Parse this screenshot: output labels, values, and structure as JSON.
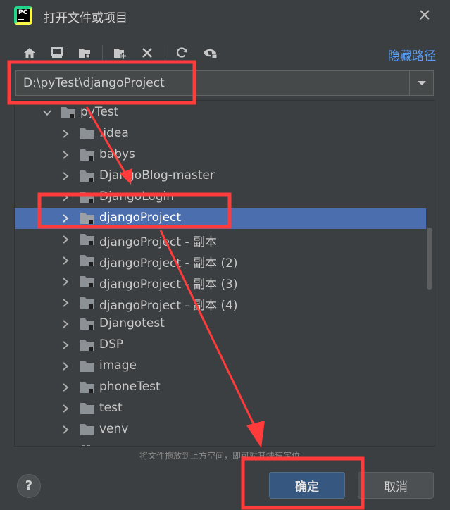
{
  "dialog": {
    "title": "打开文件或项目",
    "app_icon_text": "PC"
  },
  "toolbar": {
    "hide_path_label": "隐藏路径"
  },
  "path_field": {
    "value": "D:\\pyTest\\djangoProject"
  },
  "tree": {
    "root_label": "pyTest",
    "items": [
      {
        "label": ".idea"
      },
      {
        "label": "babys"
      },
      {
        "label": "DjangoBlog-master"
      },
      {
        "label": "DjangoLogin"
      },
      {
        "label": "djangoProject"
      },
      {
        "label": "djangoProject - 副本"
      },
      {
        "label": "djangoProject - 副本 (2)"
      },
      {
        "label": "djangoProject - 副本 (3)"
      },
      {
        "label": "djangoProject - 副本 (4)"
      },
      {
        "label": "Djangotest"
      },
      {
        "label": "DSP"
      },
      {
        "label": "image"
      },
      {
        "label": "phoneTest"
      },
      {
        "label": "test"
      },
      {
        "label": "venv"
      }
    ]
  },
  "footer": {
    "hint": "将文件拖放到上方空间，即可对其快速定位",
    "help_label": "?",
    "ok_label": "确定",
    "cancel_label": "取消"
  },
  "colors": {
    "background": "#3c3f41",
    "selection": "#4b6eaf",
    "link": "#589df6",
    "annotation": "#ff3b3b"
  }
}
